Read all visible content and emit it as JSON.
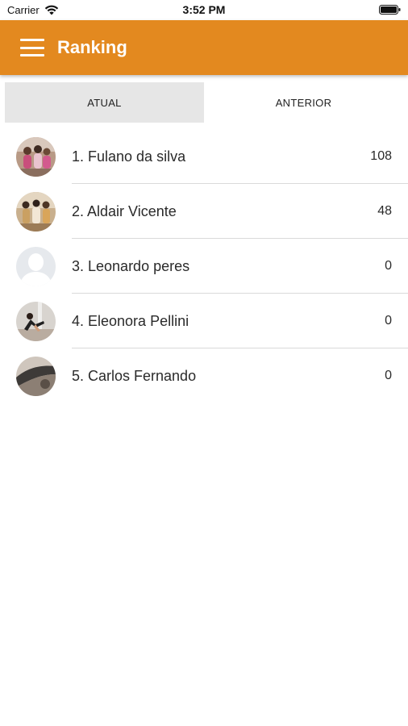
{
  "status_bar": {
    "carrier": "Carrier",
    "time": "3:52 PM"
  },
  "app_bar": {
    "title": "Ranking",
    "color": "#e3891f"
  },
  "tabs": [
    {
      "label": "ATUAL",
      "active": true
    },
    {
      "label": "ANTERIOR",
      "active": false
    }
  ],
  "ranking": [
    {
      "label": "1. Fulano da silva",
      "score": "108",
      "avatar": "photo-group"
    },
    {
      "label": "2. Aldair Vicente",
      "score": "48",
      "avatar": "photo-group"
    },
    {
      "label": "3. Leonardo peres",
      "score": "0",
      "avatar": "default-person"
    },
    {
      "label": "4. Eleonora Pellini",
      "score": "0",
      "avatar": "photo-pose"
    },
    {
      "label": "5. Carlos Fernando",
      "score": "0",
      "avatar": "photo-dark"
    }
  ]
}
